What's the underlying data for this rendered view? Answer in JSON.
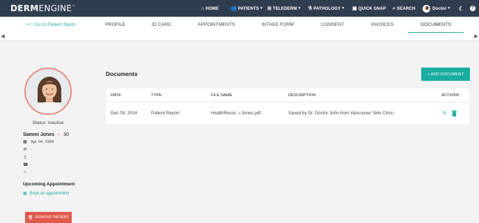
{
  "brand": {
    "logo_bold": "DERM",
    "logo_light": "ENGINE",
    "logo_tm": "™"
  },
  "nav": {
    "home": "HOME",
    "patients": "PATIENTS",
    "telederm": "TELEDERM",
    "pathology": "PATHOLOGY",
    "quick_snap": "QUICK SNAP",
    "search": "SEARCH",
    "user": "Doctor"
  },
  "tabs": {
    "back": "Go to Patient Spots",
    "items": [
      "PROFILE",
      "ID CARD",
      "APPOINTMENTS",
      "INTAKE FORM",
      "CONSENT",
      "INVOICES",
      "DOCUMENTS"
    ],
    "active": "DOCUMENTS"
  },
  "patient": {
    "status": "Status: Inactive",
    "name": "Sammi Jones",
    "gender_symbol": "♀",
    "age": "30",
    "dob": "Apr 04, 1994",
    "email": "-",
    "phone": "-",
    "work_phone": "-",
    "address": "-"
  },
  "appointment": {
    "heading": "Upcoming Appointment",
    "book_link": "Book an appointment"
  },
  "remove_button": "REMOVE PATIENT",
  "documents": {
    "title": "Documents",
    "add_button": "+ ADD DOCUMENT",
    "columns": [
      "DATE",
      "TYPE",
      "FILE NAME",
      "DESCRIPTION",
      "ACTIONS"
    ],
    "rows": [
      {
        "date": "Dec 09, 2024",
        "type": "Patient Report",
        "file_name": "HealthRecor...i Jones.pdf",
        "description": "Saved by Dr. Doctor John from Vancouver Skin Clinic."
      }
    ]
  },
  "colors": {
    "accent": "#1aaea0",
    "topbar": "#2f3e4f",
    "danger": "#e05a4e",
    "photo_border": "#e8897b"
  }
}
